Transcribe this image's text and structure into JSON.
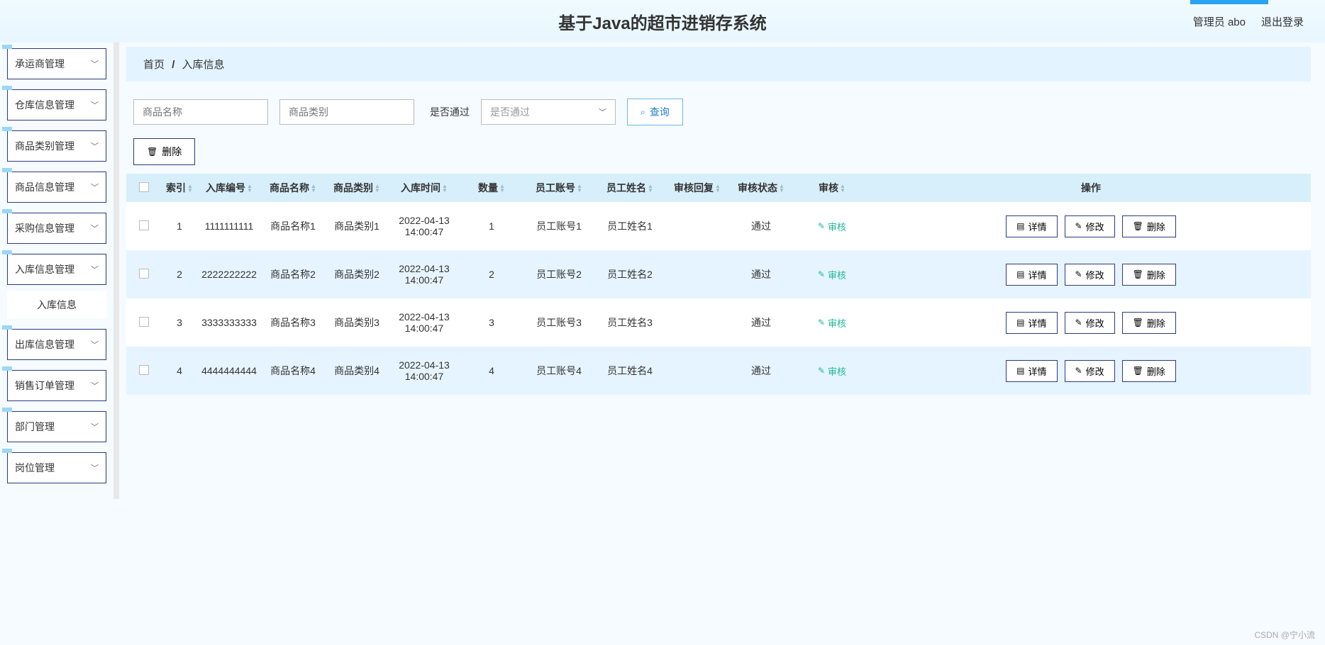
{
  "header": {
    "title": "基于Java的超市进销存系统",
    "user_label": "管理员 abo",
    "logout": "退出登录"
  },
  "sidebar": {
    "items": [
      {
        "label": "承运商管理"
      },
      {
        "label": "仓库信息管理"
      },
      {
        "label": "商品类别管理"
      },
      {
        "label": "商品信息管理"
      },
      {
        "label": "采购信息管理"
      },
      {
        "label": "入库信息管理"
      },
      {
        "label": "出库信息管理"
      },
      {
        "label": "销售订单管理"
      },
      {
        "label": "部门管理"
      },
      {
        "label": "岗位管理"
      }
    ],
    "active_sub": "入库信息"
  },
  "breadcrumb": {
    "home": "首页",
    "current": "入库信息"
  },
  "filters": {
    "name_placeholder": "商品名称",
    "category_placeholder": "商品类别",
    "pass_label": "是否通过",
    "pass_placeholder": "是否通过",
    "query": "查询"
  },
  "toolbar": {
    "delete": "删除"
  },
  "table": {
    "headers": {
      "index": "索引",
      "code": "入库编号",
      "name": "商品名称",
      "category": "商品类别",
      "time": "入库时间",
      "qty": "数量",
      "account": "员工账号",
      "empname": "员工姓名",
      "reply": "审核回复",
      "status": "审核状态",
      "audit": "审核",
      "ops": "操作"
    },
    "audit_action": "审核",
    "op_detail": "详情",
    "op_edit": "修改",
    "op_delete": "删除",
    "rows": [
      {
        "index": "1",
        "code": "1111111111",
        "name": "商品名称1",
        "category": "商品类别1",
        "time": "2022-04-13 14:00:47",
        "qty": "1",
        "account": "员工账号1",
        "empname": "员工姓名1",
        "reply": "",
        "status": "通过"
      },
      {
        "index": "2",
        "code": "2222222222",
        "name": "商品名称2",
        "category": "商品类别2",
        "time": "2022-04-13 14:00:47",
        "qty": "2",
        "account": "员工账号2",
        "empname": "员工姓名2",
        "reply": "",
        "status": "通过"
      },
      {
        "index": "3",
        "code": "3333333333",
        "name": "商品名称3",
        "category": "商品类别3",
        "time": "2022-04-13 14:00:47",
        "qty": "3",
        "account": "员工账号3",
        "empname": "员工姓名3",
        "reply": "",
        "status": "通过"
      },
      {
        "index": "4",
        "code": "4444444444",
        "name": "商品名称4",
        "category": "商品类别4",
        "time": "2022-04-13 14:00:47",
        "qty": "4",
        "account": "员工账号4",
        "empname": "员工姓名4",
        "reply": "",
        "status": "通过"
      }
    ]
  },
  "watermark": "CSDN @宁小流"
}
